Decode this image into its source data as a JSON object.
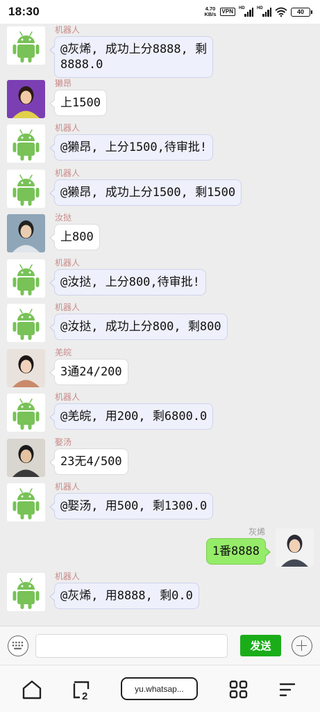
{
  "status_bar": {
    "time": "18:30",
    "net_speed_value": "4.70",
    "net_speed_unit": "KB/s",
    "vpn": "VPN",
    "signal_label": "HD",
    "battery": "40"
  },
  "robot_name": "机器人",
  "messages": [
    {
      "sender": "机器人",
      "text": "@灰烯, 成功上分8888, 剩\n8888.0",
      "type": "robot",
      "avatar": "android-robot-avatar"
    },
    {
      "sender": "獭昂",
      "text": "上1500",
      "type": "user",
      "avatar": "user-avatar-girl-braids"
    },
    {
      "sender": "机器人",
      "text": "@獭昂, 上分1500,待审批!",
      "type": "robot",
      "avatar": "android-robot-avatar"
    },
    {
      "sender": "机器人",
      "text": "@獭昂, 成功上分1500, 剩1500",
      "type": "robot",
      "avatar": "android-robot-avatar"
    },
    {
      "sender": "汝挞",
      "text": "上800",
      "type": "user",
      "avatar": "user-avatar-young-man"
    },
    {
      "sender": "机器人",
      "text": "@汝挞, 上分800,待审批!",
      "type": "robot",
      "avatar": "android-robot-avatar"
    },
    {
      "sender": "机器人",
      "text": "@汝挞, 成功上分800, 剩800",
      "type": "robot",
      "avatar": "android-robot-avatar"
    },
    {
      "sender": "羌皖",
      "text": "3通24/200",
      "type": "user",
      "avatar": "user-avatar-girl-bun"
    },
    {
      "sender": "机器人",
      "text": "@羌皖, 用200, 剩6800.0",
      "type": "robot",
      "avatar": "android-robot-avatar"
    },
    {
      "sender": "娶汤",
      "text": "23无4/500",
      "type": "user",
      "avatar": "user-avatar-man-cap"
    },
    {
      "sender": "机器人",
      "text": "@娶汤, 用500, 剩1300.0",
      "type": "robot",
      "avatar": "android-robot-avatar"
    },
    {
      "sender": "灰烯",
      "text": "1番8888",
      "type": "mine",
      "avatar": "user-avatar-self"
    },
    {
      "sender": "机器人",
      "text": "@灰烯, 用8888, 剩0.0",
      "type": "robot",
      "avatar": "android-robot-avatar"
    }
  ],
  "input_bar": {
    "placeholder": "",
    "send_label": "发送"
  },
  "nav_bar": {
    "tab_count": "2",
    "url": "yu.whatsap..."
  },
  "colors": {
    "send_button": "#1aad19",
    "mine_bubble": "#95ec69",
    "robot_bubble": "#eef0fb",
    "android_green": "#78c257",
    "sender_name": "#c98a8a"
  }
}
